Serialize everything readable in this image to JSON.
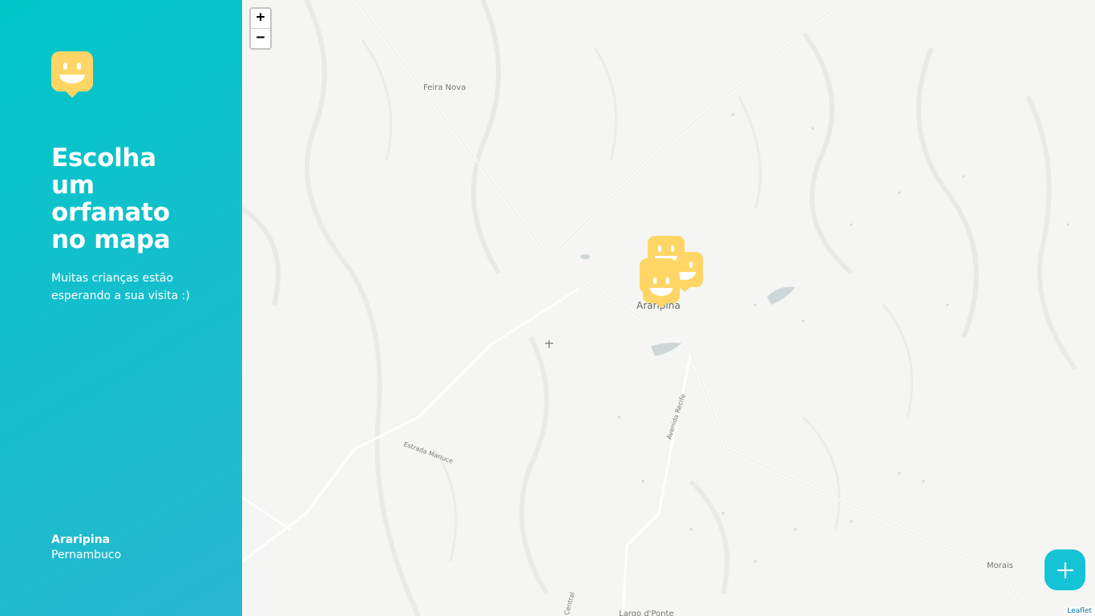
{
  "sidebar": {
    "logo_icon": "happy-map-marker-icon",
    "title_line1": "Escolha um",
    "title_line2": "orfanato",
    "title_line3": "no mapa",
    "description": "Muitas crianças estão esperando a sua visita :)",
    "city": "Araripina",
    "state": "Pernambuco",
    "gradient": [
      "#29B6D1",
      "#00C7C7"
    ]
  },
  "map": {
    "zoom_in_label": "+",
    "zoom_out_label": "−",
    "labels": {
      "feira_nova": "Feira Nova",
      "araripina": "Araripina",
      "estrada_mariuce": "Estrada Mariuce",
      "avenida_recife": "Avenida Recife",
      "morais": "Morais",
      "central": "Central",
      "bottom_partial": "Largo d'Ponte"
    },
    "attribution": "Leaflet",
    "marker_color": "#FFD666",
    "marker_count": 4
  },
  "add_button": {
    "icon": "plus-icon",
    "color": "#15C3D6"
  }
}
